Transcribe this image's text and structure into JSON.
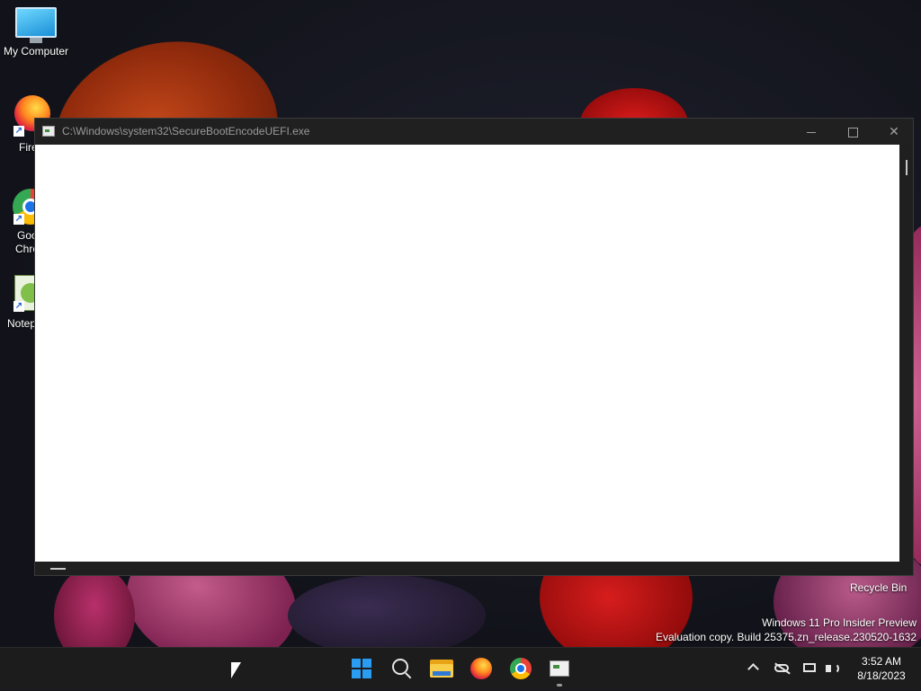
{
  "desktop": {
    "icons": [
      {
        "label": "My Computer",
        "icon": "monitor-icon"
      },
      {
        "label": "Fire",
        "icon": "firefox-icon"
      },
      {
        "label": "Goo",
        "line2": "Chro",
        "icon": "chrome-icon"
      },
      {
        "label": "Notep",
        "icon": "notepad-icon"
      }
    ],
    "recycle_bin": "Recycle Bin",
    "watermark": {
      "line1": "Windows 11 Pro Insider Preview",
      "line2": "Evaluation copy. Build 25375.zn_release.230520-1632"
    }
  },
  "window": {
    "title": "C:\\Windows\\system32\\SecureBootEncodeUEFI.exe",
    "icon": "console-app-icon",
    "buttons": {
      "minimize": "minimize",
      "maximize": "maximize",
      "close": "✕"
    },
    "console_text": ""
  },
  "taskbar": {
    "apps": [
      "start",
      "search",
      "file-explorer",
      "firefox",
      "chrome",
      "console-window"
    ],
    "active_app": "console-window",
    "tray": {
      "overflow": "show-hidden-icons",
      "onedrive": "onedrive-offline",
      "network": "network",
      "volume": "volume"
    },
    "clock": {
      "time": "3:52 AM",
      "date": "8/18/2023"
    }
  },
  "colors": {
    "taskbar_bg": "#1c1c1c",
    "titlebar_bg": "#202020",
    "console_bg": "#ffffff",
    "accent": "#2a9cf2"
  }
}
